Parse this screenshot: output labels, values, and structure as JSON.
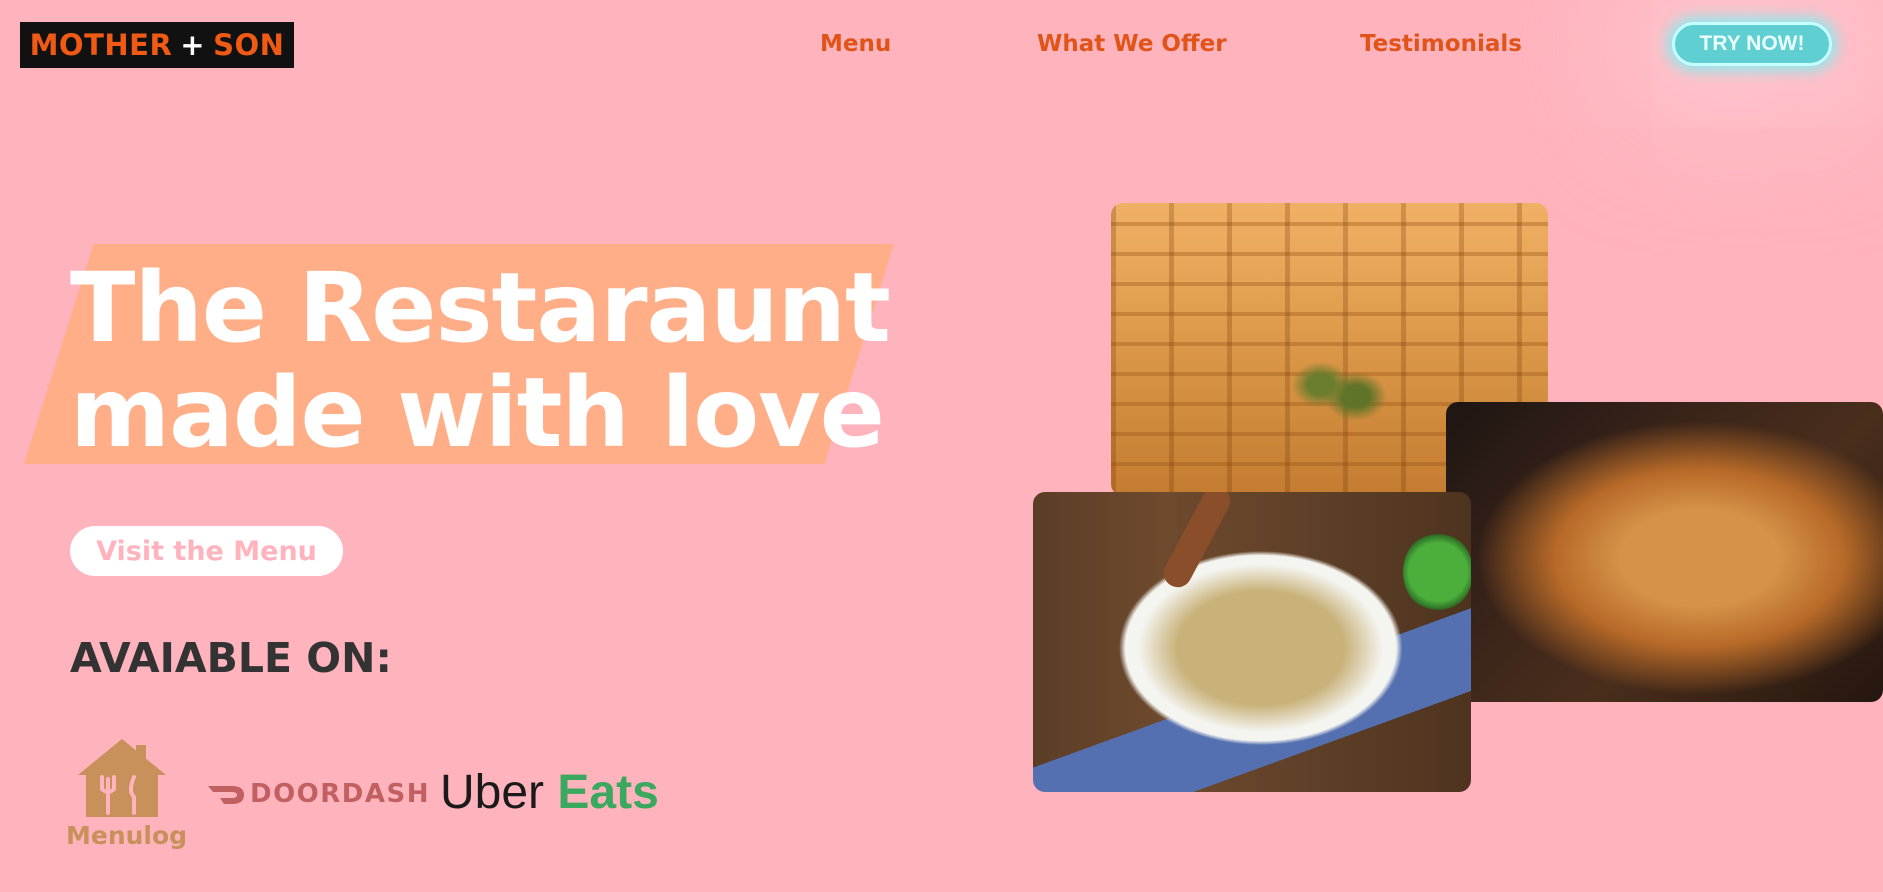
{
  "brand": {
    "word1": "MOTHER",
    "plus": "+",
    "word2": "SON"
  },
  "nav": [
    {
      "label": "Menu"
    },
    {
      "label": "What We Offer"
    },
    {
      "label": "Testimonials"
    }
  ],
  "cta": {
    "try_label": "TRY NOW!"
  },
  "hero": {
    "title_line1": "The Restaraunt",
    "title_line2": "made with love",
    "visit_label": "Visit the Menu"
  },
  "available": {
    "heading": "AVAIABLE ON:",
    "partners": [
      {
        "name": "Menulog",
        "icon": "menulog-house-icon",
        "color": "#c8905a"
      },
      {
        "name": "DOORDASH",
        "icon": "doordash-dash-icon",
        "color": "#c06060"
      },
      {
        "name_uber": "Uber",
        "name_eats": "Eats",
        "color_uber": "#1a1a1a",
        "color_eats": "#3aa85f"
      }
    ]
  },
  "gallery": [
    {
      "subject": "baklava-photo"
    },
    {
      "subject": "butter-chicken-photo"
    },
    {
      "subject": "vegetable-rice-photo"
    }
  ],
  "colors": {
    "background": "#ffb3bd",
    "accent_orange": "#e0541a",
    "hero_highlight": "#ffae88",
    "try_button": "#5fcfd1"
  }
}
